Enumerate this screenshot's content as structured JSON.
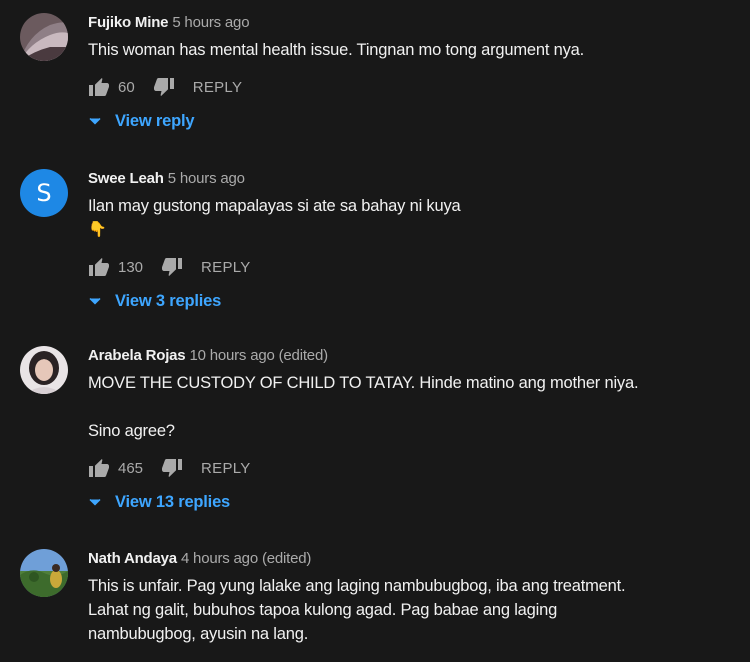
{
  "comments": [
    {
      "author": "Fujiko Mine",
      "time": "5 hours ago",
      "edited": "",
      "lines": [
        "This woman has mental health issue. Tingnan mo tong argument nya."
      ],
      "likes": "60",
      "reply_label": "REPLY",
      "view_replies": "View reply"
    },
    {
      "author": "Swee Leah",
      "time": "5 hours ago",
      "edited": "",
      "avatar_letter": "S",
      "lines": [
        "Ilan may gustong mapalayas si ate sa bahay ni kuya",
        "👇"
      ],
      "likes": "130",
      "reply_label": "REPLY",
      "view_replies": "View 3 replies"
    },
    {
      "author": "Arabela Rojas",
      "time": "10 hours ago",
      "edited": "(edited)",
      "lines": [
        "MOVE THE CUSTODY OF CHILD TO TATAY. Hinde matino ang mother niya.",
        "Sino agree?"
      ],
      "likes": "465",
      "reply_label": "REPLY",
      "view_replies": "View 13 replies"
    },
    {
      "author": "Nath Andaya",
      "time": "4 hours ago",
      "edited": "(edited)",
      "lines": [
        "This is unfair. Pag yung lalake ang laging nambubugbog, iba ang treatment.",
        "Lahat ng galit, bubuhos tapoa kulong agad. Pag babae ang laging",
        "nambubugbog, ayusin na lang."
      ]
    }
  ],
  "colors": {
    "background": "#181818",
    "text": "#f1f1f1",
    "secondary": "#aaaaaa",
    "link": "#3ea6ff",
    "avatar_s": "#1e88e5"
  },
  "icons": {
    "like": "thumb-up-icon",
    "dislike": "thumb-down-icon",
    "expand": "chevron-down-icon"
  }
}
